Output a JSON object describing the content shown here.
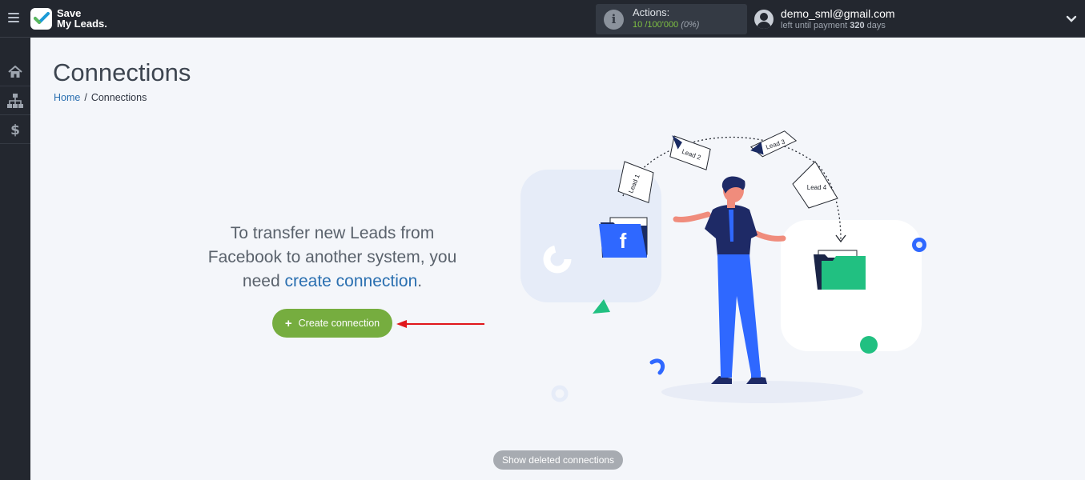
{
  "app": {
    "logo_line1": "Save",
    "logo_line2": "My Leads."
  },
  "header": {
    "actions_label": "Actions:",
    "actions_used": "10",
    "actions_total": "/100'000",
    "actions_percent": "(0%)",
    "user_email": "demo_sml@gmail.com",
    "payment_prefix": "left until payment",
    "payment_days": "320",
    "payment_suffix": "days"
  },
  "sidebar": {
    "items": [
      {
        "icon": "home-icon"
      },
      {
        "icon": "sitemap-icon"
      },
      {
        "icon": "dollar-icon"
      }
    ]
  },
  "main": {
    "title": "Connections",
    "breadcrumb": {
      "home": "Home",
      "separator": "/",
      "current": "Connections"
    },
    "message_line1": "To transfer new Leads from",
    "message_line2": "Facebook to another system, you",
    "message_line3_prefix": "need",
    "message_link": "create connection",
    "message_end": ".",
    "create_button": "Create connection",
    "show_deleted_button": "Show deleted connections"
  },
  "illustration": {
    "leads": [
      "Lead 1",
      "Lead 2",
      "Lead 3",
      "Lead 4"
    ],
    "source_letter": "f"
  },
  "colors": {
    "topbar": "#23272f",
    "accent_green": "#76ad3f",
    "link_blue": "#2a6fb0",
    "arrow_red": "#e0161b"
  }
}
